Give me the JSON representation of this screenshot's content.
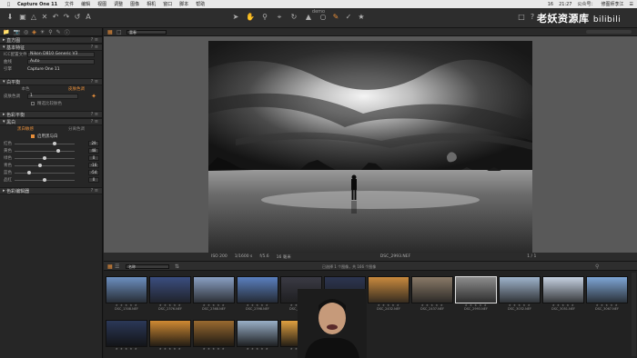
{
  "menubar": {
    "app_name": "Capture One 11",
    "menus": [
      "文件",
      "编辑",
      "视图",
      "调整",
      "图像",
      "相机",
      "窗口",
      "脚本",
      "帮助"
    ],
    "status_percent": "16",
    "time": "21:27",
    "public_account": "公众号：",
    "user": "修图师李江"
  },
  "window": {
    "title": "demo"
  },
  "watermark": {
    "text": "老妖资源库",
    "brand": "bilibili"
  },
  "left_panel": {
    "sections": {
      "histogram": "直方图",
      "base_characteristics": "基本特征",
      "white_balance": "白平衡",
      "color_balance": "色彩平衡",
      "black_white": "黑白",
      "color_editor": "色彩编辑器"
    },
    "icc_label": "ICC配置文件",
    "icc_value": "Nikon D810 Generic V3",
    "curve_label": "曲线",
    "curve_value": "Auto",
    "engine_label": "引擎",
    "engine_value": "Capture One 11",
    "wb_tabs": [
      "本色",
      "皮肤色调"
    ],
    "skin_label": "皮肤色调",
    "skin_value": "1",
    "uniform_label": "精选比较肤色",
    "bw_tabs": [
      "黑白敏感",
      "分离色调"
    ],
    "enable_bw": "启用黑与白",
    "sliders": [
      {
        "label": "红色",
        "value": "29",
        "pos": 0.68
      },
      {
        "label": "黄色",
        "value": "48",
        "pos": 0.74
      },
      {
        "label": "绿色",
        "value": "0",
        "pos": 0.5
      },
      {
        "label": "青色",
        "value": "-16",
        "pos": 0.42
      },
      {
        "label": "蓝色",
        "value": "-54",
        "pos": 0.23
      },
      {
        "label": "品红",
        "value": "0",
        "pos": 0.5
      }
    ]
  },
  "viewer": {
    "variant_select": "富春",
    "info": [
      "ISO 200",
      "1/1600 s",
      "f/5.6",
      "16 毫米"
    ],
    "filename": "DSC_2993.NEF",
    "counter": "1 / 1"
  },
  "browser": {
    "sort_label": "名称",
    "status": "已选择 1 个图像，共 166 个图像",
    "thumbnails": [
      {
        "name": "DSC_1308.NEF",
        "tone": "#6c8fc0"
      },
      {
        "name": "DSC_2376.NEF",
        "tone": "#3b4e80"
      },
      {
        "name": "DSC_2368.NEF",
        "tone": "#8aa0c4"
      },
      {
        "name": "DSC_2398.NEF",
        "tone": "#5a7fbf"
      },
      {
        "name": "DSC_2396.NEF",
        "tone": "#3a3a44"
      },
      {
        "name": "DSC_2399.NEF",
        "tone": "#2c3550"
      },
      {
        "name": "DSC_2432.NEF",
        "tone": "#c98a3e"
      },
      {
        "name": "DSC_2437.NEF",
        "tone": "#8a7a68"
      },
      {
        "name": "DSC_2993.NEF",
        "tone": "#8d8d8d"
      },
      {
        "name": "DSC_3032.NEF",
        "tone": "#9fb4cc"
      },
      {
        "name": "DSC_3051.NEF",
        "tone": "#c6d2e2"
      },
      {
        "name": "DSC_3067.NEF",
        "tone": "#7ea6d6"
      }
    ]
  },
  "colors": {
    "accent": "#e58d3a",
    "panel": "#262626",
    "viewer_bg": "#595959"
  }
}
